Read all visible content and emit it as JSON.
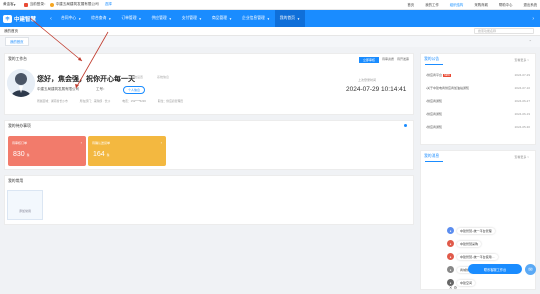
{
  "topbar": {
    "left_text": "黄金客",
    "menu1": "",
    "guest_text": "当前登录：",
    "company_prefix": "中建五局建筑发展有限公司",
    "company_suffix": "选择",
    "right_items": [
      "首页",
      "我的工作",
      "组织结构",
      "采购商城",
      "帮助中心",
      "退出系统"
    ],
    "highlight_index": 2
  },
  "nav": {
    "logo_mark": "中",
    "logo_text": "中建智慧",
    "items": [
      {
        "label": "合同中心",
        "active": false
      },
      {
        "label": "综合查询",
        "active": false
      },
      {
        "label": "订单管理",
        "active": false
      },
      {
        "label": "供应管理",
        "active": false
      },
      {
        "label": "支付管理",
        "active": false
      },
      {
        "label": "商品管理",
        "active": false
      },
      {
        "label": "企业信息管理",
        "active": false
      },
      {
        "label": "我的首页",
        "active": true
      }
    ]
  },
  "tabbar": {
    "tab": "我的首页",
    "search_placeholder": "搜索功能名称"
  },
  "subbar": {
    "chip": "我的首页"
  },
  "workbench": {
    "title": "我的工作台",
    "btn_primary": "立即审核",
    "btn2": "待审资质",
    "btn3": "待开发票",
    "greeting": "您好，焦会强，祝你开心每一天",
    "extra1": "系统设置",
    "extra2": "系统信息",
    "company": "中建五局建筑发展有限公司",
    "work_label": "工号：",
    "personal_btn": "个人信息",
    "info1": "所属区域：湖南省长沙市",
    "info2": "所在部门：采购部 · 长沙",
    "info3": "电话：152****5236",
    "info4": "职位：供应商管理员",
    "last_login_label": "上次登录时间",
    "datetime": "2024-07-29 10:14:41"
  },
  "todo": {
    "title": "我的待办事项",
    "cards": [
      {
        "label": "待审核订单",
        "value": "830",
        "unit": "条",
        "color": "#f27b6b"
      },
      {
        "label": "待确认送货单",
        "value": "164",
        "unit": "条",
        "color": "#f3b840"
      }
    ]
  },
  "recent": {
    "title": "我的常用",
    "tile_label": "添加常用"
  },
  "notice": {
    "title": "我的公告",
    "more": "查看更多 >",
    "rows": [
      {
        "title": "•供应商平台",
        "new": "NEW",
        "date": "2024-07-29"
      },
      {
        "title": "•关于中建电商供应商加油站通知",
        "new": "",
        "date": "2024-07-10"
      },
      {
        "title": "•供应商通知",
        "new": "",
        "date": "2024-06-27"
      },
      {
        "title": "•供应商通知",
        "new": "",
        "date": "2024-06-19"
      },
      {
        "title": "•供应商通知",
        "new": "",
        "date": "2024-05-30"
      }
    ]
  },
  "forum": {
    "title": "我的消息",
    "more": "查看更多 >"
  },
  "popup": {
    "items": [
      {
        "label": "中建智慧–统一平台管理",
        "color": "#5b8def"
      },
      {
        "label": "中建智慧采购",
        "color": "#e05a4a"
      },
      {
        "label": "中建智慧–统一平台使用…",
        "color": "#e05a4a"
      },
      {
        "label": "商城供应商账号",
        "color": "#888"
      },
      {
        "label": "中建空间",
        "color": "#666"
      }
    ],
    "chat_label": "联系客服工作台",
    "fab": "✉",
    "close": "✕ ⚙"
  }
}
